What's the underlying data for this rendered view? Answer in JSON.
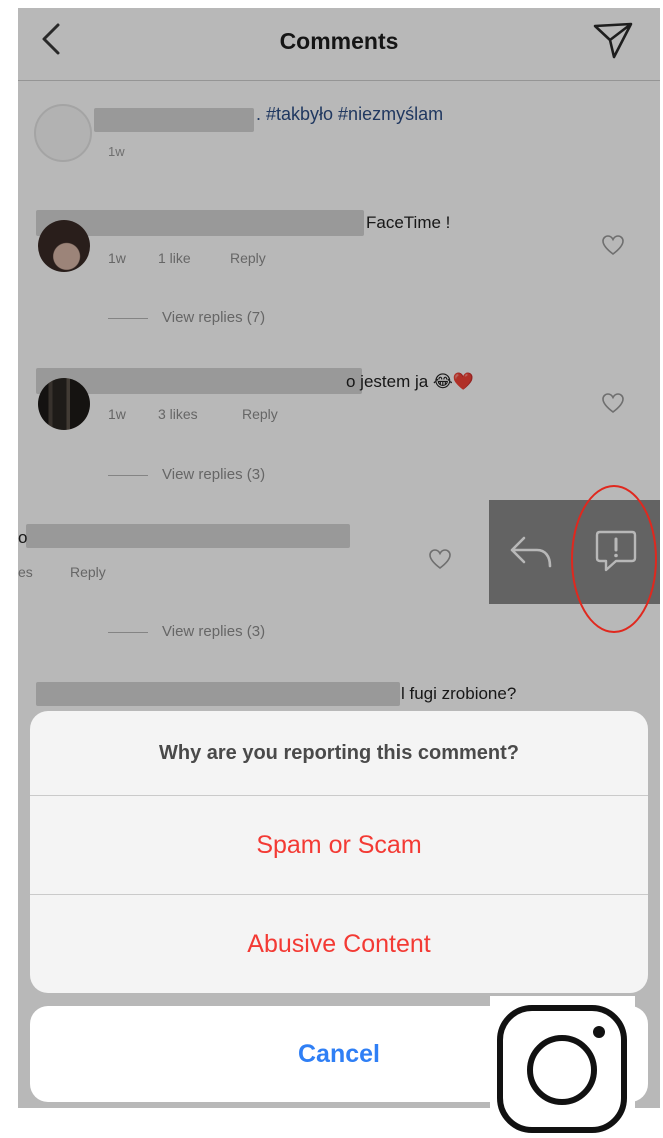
{
  "header": {
    "title": "Comments",
    "back_icon": "chevron-left-icon",
    "share_icon": "paper-plane-icon"
  },
  "caption": {
    "text": ". #takbyło #niezmyślam",
    "time": "1w"
  },
  "comments": [
    {
      "text": "FaceTime !",
      "time": "1w",
      "likes": "1 like",
      "reply": "Reply",
      "view_replies": "View replies (7)"
    },
    {
      "text": "o jestem ja 😂❤️",
      "time": "1w",
      "likes": "3 likes",
      "reply": "Reply",
      "view_replies": "View replies (3)"
    },
    {
      "text": "o",
      "likes": "es",
      "reply": "Reply",
      "view_replies": "View replies (3)"
    },
    {
      "text": "l fugi zrobione?"
    }
  ],
  "swipe_actions": {
    "reply_icon": "reply-arrow-icon",
    "report_icon": "report-flag-icon"
  },
  "action_sheet": {
    "title": "Why are you reporting this comment?",
    "options": [
      "Spam or Scam",
      "Abusive Content"
    ],
    "cancel": "Cancel"
  },
  "colors": {
    "destructive": "#f33a34",
    "cancel": "#2f7ff5",
    "hashtag": "#2d4e86",
    "highlight": "#e0281e"
  }
}
